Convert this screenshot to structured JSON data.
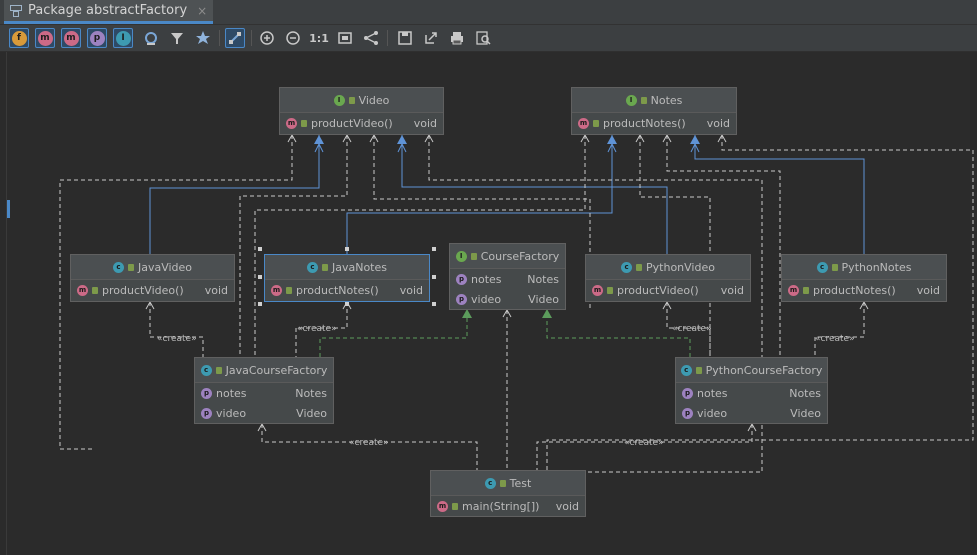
{
  "tab": {
    "title": "Package abstractFactory",
    "close": "×"
  },
  "toolbar": {
    "f": "f",
    "m": "m",
    "p": "p",
    "i": "I",
    "zoom_actual": "1:1"
  },
  "colors": {
    "class_icon": "#3d9ab1",
    "interface_icon": "#6aa84f",
    "method_icon": "#cc6a87",
    "property_icon": "#9d82c0",
    "realization": "#4a88c7",
    "dependency": "#c8c8c8",
    "implements_green": "#5c9c5c"
  },
  "nodes": {
    "video": {
      "title": "Video",
      "rows": [
        {
          "name": "productVideo()",
          "type": "void"
        }
      ]
    },
    "notes": {
      "title": "Notes",
      "rows": [
        {
          "name": "productNotes()",
          "type": "void"
        }
      ]
    },
    "java_video": {
      "title": "JavaVideo",
      "rows": [
        {
          "name": "productVideo()",
          "type": "void"
        }
      ]
    },
    "java_notes": {
      "title": "JavaNotes",
      "rows": [
        {
          "name": "productNotes()",
          "type": "void"
        }
      ]
    },
    "course_factory": {
      "title": "CourseFactory",
      "rows": [
        {
          "name": "notes",
          "type": "Notes"
        },
        {
          "name": "video",
          "type": "Video"
        }
      ]
    },
    "python_video": {
      "title": "PythonVideo",
      "rows": [
        {
          "name": "productVideo()",
          "type": "void"
        }
      ]
    },
    "python_notes": {
      "title": "PythonNotes",
      "rows": [
        {
          "name": "productNotes()",
          "type": "void"
        }
      ]
    },
    "java_course_factory": {
      "title": "JavaCourseFactory",
      "rows": [
        {
          "name": "notes",
          "type": "Notes"
        },
        {
          "name": "video",
          "type": "Video"
        }
      ]
    },
    "python_course_factory": {
      "title": "PythonCourseFactory",
      "rows": [
        {
          "name": "notes",
          "type": "Notes"
        },
        {
          "name": "video",
          "type": "Video"
        }
      ]
    },
    "test": {
      "title": "Test",
      "rows": [
        {
          "name": "main(String[])",
          "type": "void"
        }
      ]
    }
  },
  "edge_labels": {
    "create": "«create»"
  }
}
